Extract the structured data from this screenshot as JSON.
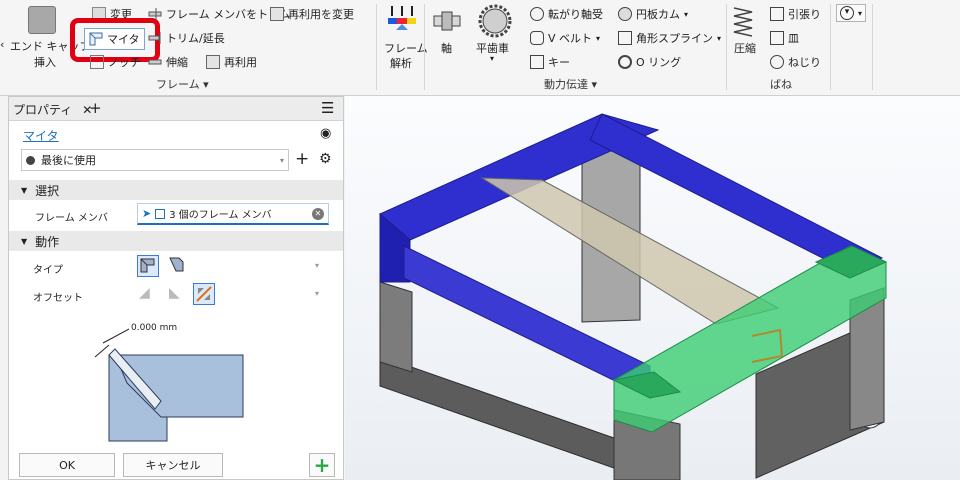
{
  "ribbon": {
    "insert": {
      "top": "エンド キャップ",
      "bottom": "挿入"
    },
    "items": {
      "change": "変更",
      "miter": "マイタ",
      "notch": "ノッチ",
      "trim_to_frame": "フレーム メンバをトリム",
      "trim_extend": "トリム/延長",
      "lengthen": "伸縮",
      "change_reuse": "再利用を変更",
      "reuse": "再利用",
      "frame_analysis_top": "フレーム",
      "frame_analysis_bottom": "解析",
      "shaft": "軸",
      "spur_gear": "平歯車",
      "bearing": "転がり軸受",
      "v_belt": "V ベルト",
      "key": "キー",
      "disc_cam": "円板カム",
      "rect_spline": "角形スプライン",
      "o_ring": "O リング",
      "compression": "圧縮",
      "tension": "引張り",
      "belleville": "皿",
      "torsion": "ねじり"
    },
    "group_labels": {
      "frame": "フレーム",
      "power_transmission": "動力伝達",
      "spring": "ばね"
    }
  },
  "panel": {
    "tab_title": "プロパティ",
    "command_name": "マイタ",
    "preset": "最後に使用",
    "section_select": "選択",
    "frame_member_label": "フレーム メンバ",
    "frame_member_value": "3 個のフレーム メンバ",
    "section_action": "動作",
    "type_label": "タイプ",
    "offset_label": "オフセット",
    "offset_value": "0.000 mm",
    "ok": "OK",
    "cancel": "キャンセル"
  },
  "colors": {
    "accent_red": "#e00012",
    "blue_frame": "#2f2fd0",
    "green_selection": "#3ccd72",
    "tan_member": "#cfc7ae"
  }
}
